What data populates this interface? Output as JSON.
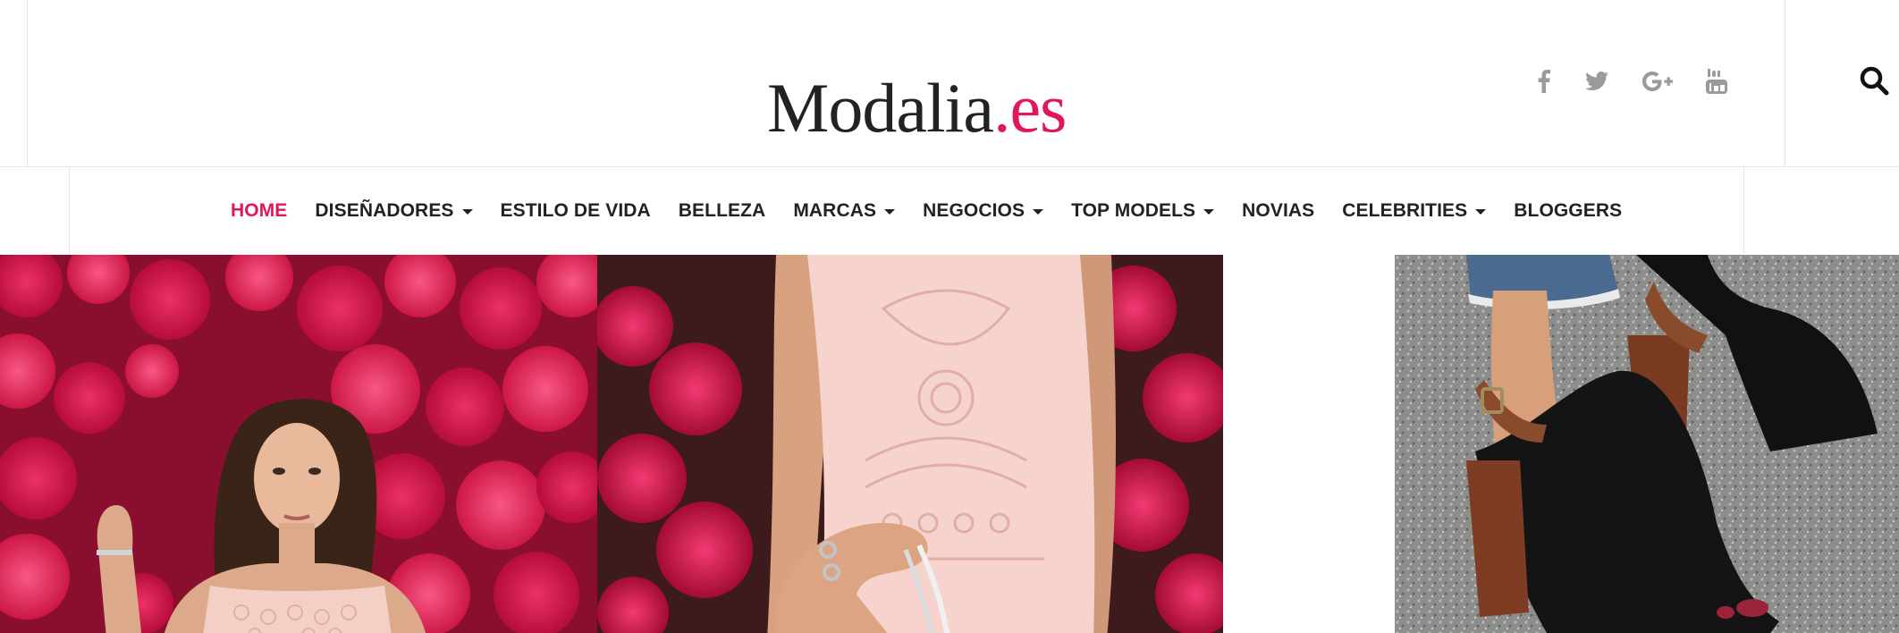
{
  "logo": {
    "main": "Modalia",
    "domain": ".es"
  },
  "social": [
    "facebook-icon",
    "twitter-icon",
    "google-plus-icon",
    "youtube-icon"
  ],
  "nav": {
    "items": [
      {
        "label": "HOME",
        "active": true,
        "dropdown": false
      },
      {
        "label": "DISEÑADORES",
        "active": false,
        "dropdown": true
      },
      {
        "label": "ESTILO DE VIDA",
        "active": false,
        "dropdown": false
      },
      {
        "label": "BELLEZA",
        "active": false,
        "dropdown": false
      },
      {
        "label": "MARCAS",
        "active": false,
        "dropdown": true
      },
      {
        "label": "NEGOCIOS",
        "active": false,
        "dropdown": true
      },
      {
        "label": "TOP MODELS",
        "active": false,
        "dropdown": true
      },
      {
        "label": "NOVIAS",
        "active": false,
        "dropdown": false
      },
      {
        "label": "CELEBRITIES",
        "active": false,
        "dropdown": true
      },
      {
        "label": "BLOGGERS",
        "active": false,
        "dropdown": false
      }
    ]
  },
  "colors": {
    "accent": "#e0165e",
    "text": "#222222",
    "icon": "#9a9a9a"
  }
}
